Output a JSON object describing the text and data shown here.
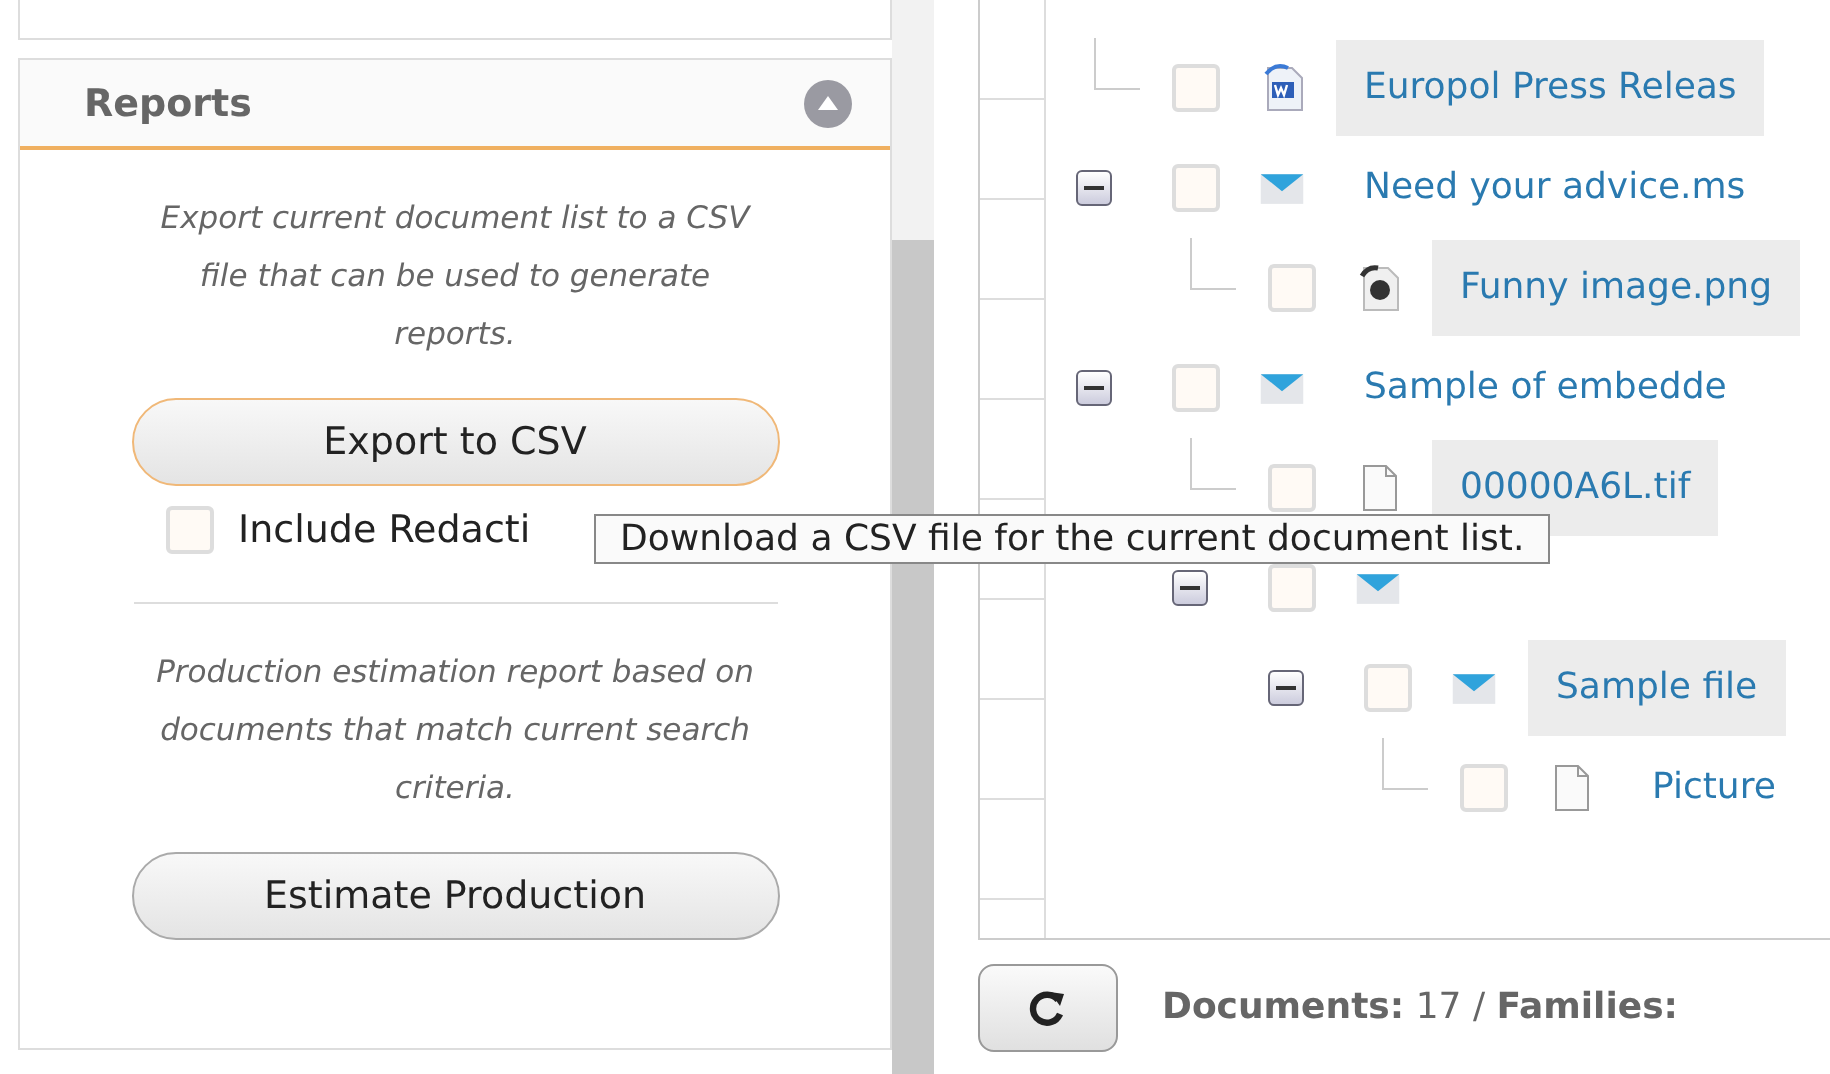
{
  "reports_panel": {
    "title": "Reports",
    "expanded": true,
    "export_description": "Export current document list to a CSV file that can be used to generate reports.",
    "export_button": "Export to CSV",
    "include_redactions": {
      "label": "Include Redacti",
      "checked": false
    },
    "estimate_description": "Production estimation report based on documents that match current search criteria.",
    "estimate_button": "Estimate Production"
  },
  "tooltip": "Download a CSV file for the current document list.",
  "tree": [
    {
      "label": "Europol Press Releas",
      "kind": "word",
      "checked": false,
      "highlighted": true
    },
    {
      "label": "Need your advice.ms",
      "kind": "email",
      "checked": false,
      "highlighted": false,
      "expanded": true,
      "children": [
        {
          "label": "Funny image.png",
          "kind": "image",
          "checked": false,
          "highlighted": true
        }
      ]
    },
    {
      "label": "Sample of embedde",
      "kind": "email",
      "checked": false,
      "highlighted": false,
      "expanded": true,
      "children": [
        {
          "label": "00000A6L.tif",
          "kind": "file",
          "checked": false,
          "highlighted": true
        },
        {
          "kind": "email",
          "checked": false,
          "expanded": true,
          "children": [
            {
              "label": "Sample file",
              "kind": "email",
              "checked": false,
              "highlighted": true,
              "expanded": true,
              "children": [
                {
                  "label": "Picture",
                  "kind": "file",
                  "checked": false,
                  "highlighted": false
                }
              ]
            }
          ]
        }
      ]
    }
  ],
  "status": "**Documents:** 17 / **Families:**"
}
